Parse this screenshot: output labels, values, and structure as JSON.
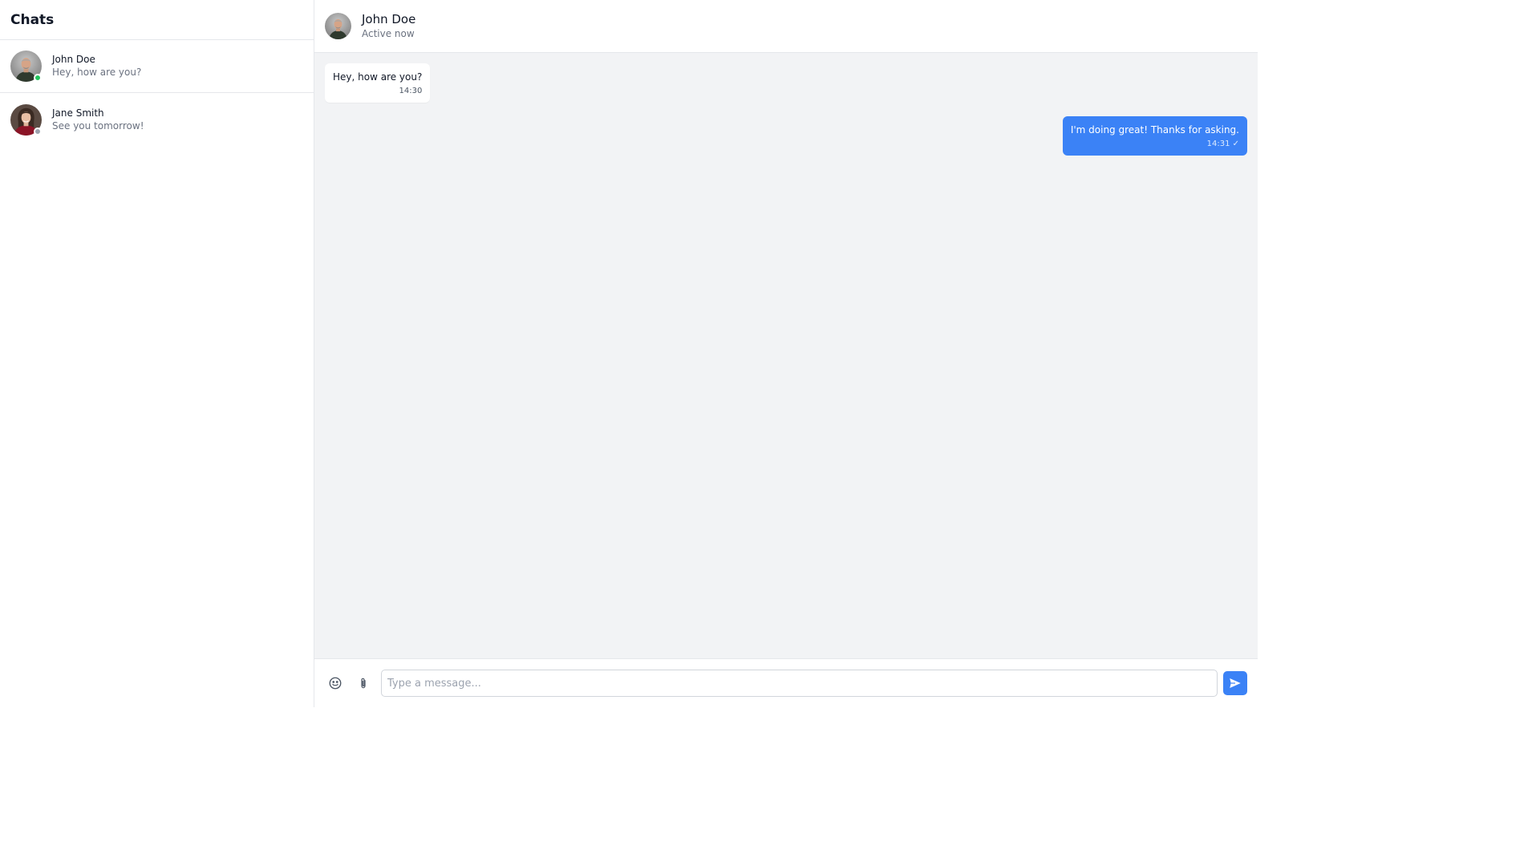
{
  "sidebar": {
    "title": "Chats",
    "chats": [
      {
        "name": "John Doe",
        "preview": "Hey, how are you?",
        "status": "online",
        "status_color": "#22c55e"
      },
      {
        "name": "Jane Smith",
        "preview": "See you tomorrow!",
        "status": "offline",
        "status_color": "#9ca3af"
      }
    ]
  },
  "conversation": {
    "contact_name": "John Doe",
    "contact_status": "Active now",
    "messages": [
      {
        "direction": "incoming",
        "text": "Hey, how are you?",
        "time": "14:30"
      },
      {
        "direction": "outgoing",
        "text": "I'm doing great! Thanks for asking.",
        "time": "14:31 ✓"
      }
    ]
  },
  "composer": {
    "placeholder": "Type a message...",
    "emoji_icon": "smiley-icon",
    "attach_icon": "paperclip-icon",
    "send_icon": "send-icon"
  },
  "colors": {
    "accent": "#3b82f6",
    "background": "#f2f3f5",
    "online": "#22c55e",
    "offline": "#9ca3af"
  }
}
